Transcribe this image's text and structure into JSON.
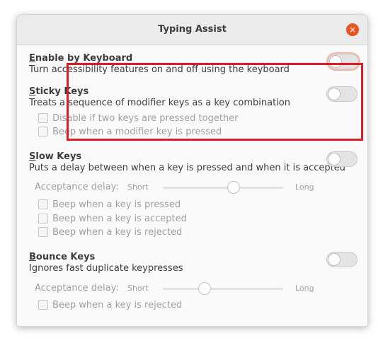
{
  "window": {
    "title": "Typing Assist",
    "close_icon": "×"
  },
  "enable_by_keyboard": {
    "mnemonic": "E",
    "title_rest": "nable by Keyboard",
    "desc": "Turn accessibility features on and off using the keyboard",
    "enabled": false
  },
  "sticky_keys": {
    "mnemonic": "S",
    "title_rest": "ticky Keys",
    "desc": "Treats a sequence of modifier keys as a key combination",
    "enabled": false,
    "options": [
      "Disable if two keys are pressed together",
      "Beep when a modifier key is pressed"
    ]
  },
  "slow_keys": {
    "mnemonic": "S",
    "title_rest": "low Keys",
    "desc": "Puts a delay between when a key is pressed and when it is accepted",
    "enabled": false,
    "delay_label": "Acceptance delay:",
    "short_label": "Short",
    "long_label": "Long",
    "delay_fraction": 0.6,
    "options": [
      "Beep when a key is pressed",
      "Beep when a key is accepted",
      "Beep when a key is rejected"
    ]
  },
  "bounce_keys": {
    "mnemonic": "B",
    "title_rest": "ounce Keys",
    "desc": "Ignores fast duplicate keypresses",
    "enabled": false,
    "delay_label": "Acceptance delay:",
    "short_label": "Short",
    "long_label": "Long",
    "delay_fraction": 0.33,
    "options": [
      "Beep when a key is rejected"
    ]
  },
  "colors": {
    "accent": "#e95420",
    "highlight": "#e01b24"
  }
}
